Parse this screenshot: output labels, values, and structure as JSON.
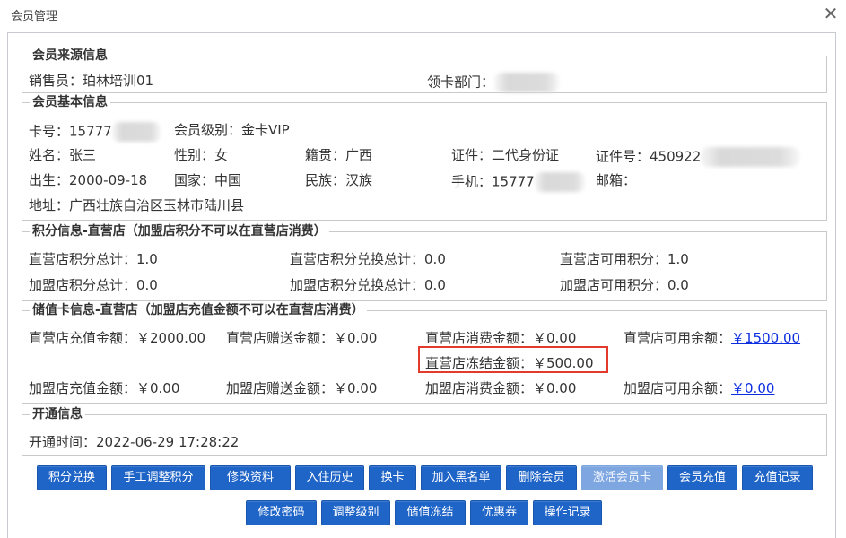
{
  "window": {
    "title": "会员管理",
    "close_glyph": "✕"
  },
  "source": {
    "legend": "会员来源信息",
    "sales": "销售员：珀林培训01",
    "dept": "领卡部门："
  },
  "basic": {
    "legend": "会员基本信息",
    "card_no": "卡号：15777",
    "level": "会员级别：金卡VIP",
    "name": "姓名：张三",
    "gender": "性别：女",
    "native": "籍贯：广西",
    "id_type": "证件：二代身份证",
    "id_no": "证件号：450922",
    "birth": "出生：2000-09-18",
    "country": "国家：中国",
    "ethnic": "民族：汉族",
    "mobile": "手机：15777",
    "email": "邮箱：",
    "address": "地址：广西壮族自治区玉林市陆川县"
  },
  "points": {
    "legend": "积分信息-直营店（加盟店积分不可以在直营店消费）",
    "d_total": "直营店积分总计：1.0",
    "d_exchange": "直营店积分兑换总计：0.0",
    "d_avail": "直营店可用积分：1.0",
    "f_total": "加盟店积分总计：0.0",
    "f_exchange": "加盟店积分兑换总计：0.0",
    "f_avail": "加盟店可用积分：0.0"
  },
  "stored": {
    "legend": "储值卡信息-直营店（加盟店充值金额不可以在直营店消费）",
    "d_recharge": "直营店充值金额：￥2000.00",
    "d_gift": "直营店赠送金额：￥0.00",
    "d_consume": "直营店消费金额：￥0.00",
    "d_balance_label": "直营店可用余额：",
    "d_balance": "￥1500.00",
    "d_frozen": "直营店冻结金额：￥500.00",
    "f_recharge": "加盟店充值金额：￥0.00",
    "f_gift": "加盟店赠送金额：￥0.00",
    "f_consume": "加盟店消费金额：￥0.00",
    "f_balance_label": "加盟店可用余额：",
    "f_balance": "￥0.00"
  },
  "open": {
    "legend": "开通信息",
    "time": "开通时间：2022-06-29 17:28:22"
  },
  "buttons_row1": [
    "积分兑换",
    "手工调整积分",
    "修改资料",
    "入住历史",
    "换卡",
    "加入黑名单",
    "删除会员",
    "激活会员卡",
    "会员充值",
    "充值记录"
  ],
  "buttons_row2": [
    "修改密码",
    "调整级别",
    "储值冻结",
    "优惠券",
    "操作记录"
  ],
  "colors": {
    "button": "#1f64c7",
    "button_disabled": "#7ea6e0",
    "link": "#0b2ee0",
    "highlight": "#e23a2b"
  }
}
